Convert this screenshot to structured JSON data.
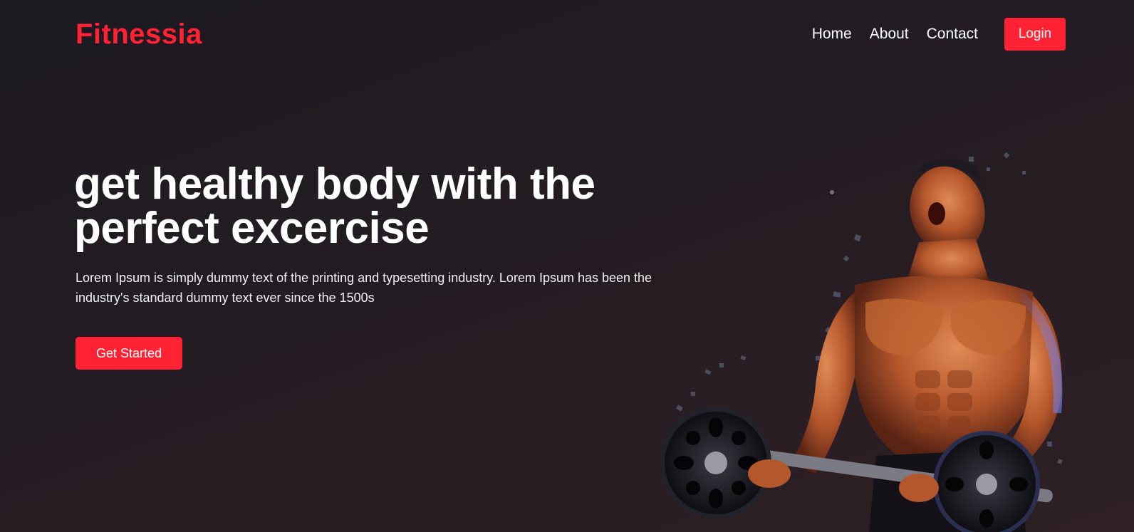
{
  "header": {
    "logo": "Fitnessia",
    "nav": [
      {
        "label": "Home"
      },
      {
        "label": "About"
      },
      {
        "label": "Contact"
      }
    ],
    "login_label": "Login"
  },
  "hero": {
    "title": "get healthy body with the perfect excercise",
    "description": "Lorem Ipsum is simply dummy text of the printing and typesetting industry. Lorem Ipsum has been the industry's standard dummy text ever since the 1500s",
    "cta_label": "Get Started",
    "image_subject": "bodybuilder-lifting-barbell"
  },
  "colors": {
    "accent": "#ff2233",
    "background": "#241c23",
    "text": "#ffffff"
  }
}
